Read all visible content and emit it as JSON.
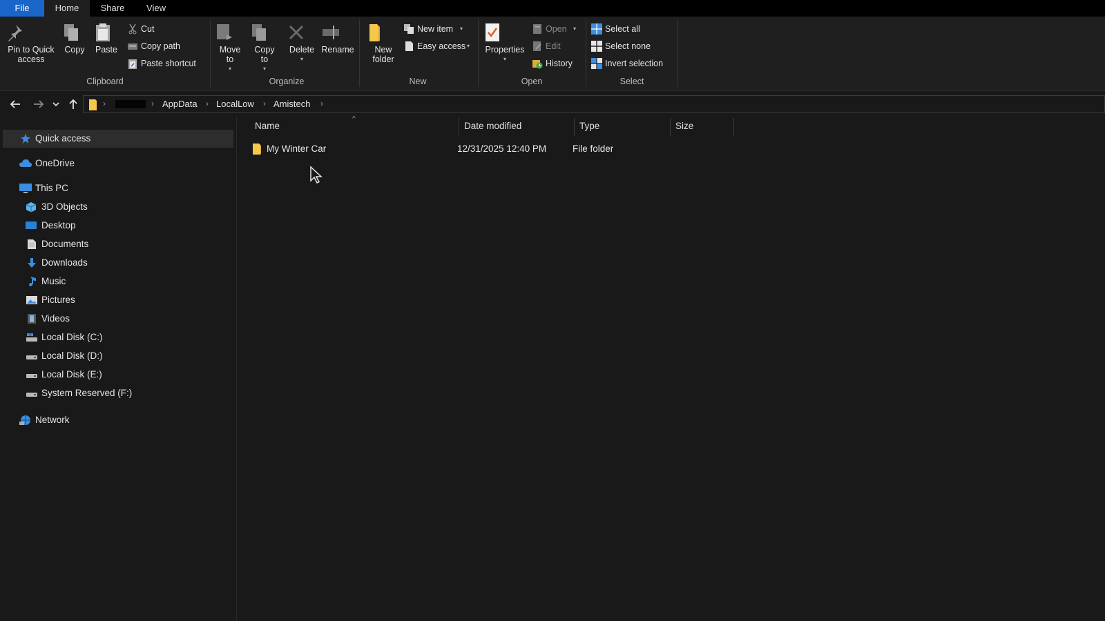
{
  "menu_tabs": {
    "file": "File",
    "home": "Home",
    "share": "Share",
    "view": "View"
  },
  "ribbon": {
    "clipboard": {
      "pin": "Pin to Quick access",
      "copy": "Copy",
      "paste": "Paste",
      "cut": "Cut",
      "copy_path": "Copy path",
      "paste_shortcut": "Paste shortcut",
      "label": "Clipboard"
    },
    "organize": {
      "move_to": "Move to",
      "copy_to": "Copy to",
      "delete": "Delete",
      "rename": "Rename",
      "label": "Organize"
    },
    "new": {
      "new_folder": "New folder",
      "new_item": "New item",
      "easy_access": "Easy access",
      "label": "New"
    },
    "open": {
      "properties": "Properties",
      "open": "Open",
      "edit": "Edit",
      "history": "History",
      "label": "Open"
    },
    "select": {
      "select_all": "Select all",
      "select_none": "Select none",
      "invert_selection": "Invert selection",
      "label": "Select"
    }
  },
  "breadcrumb": [
    "AppData",
    "LocalLow",
    "Amistech"
  ],
  "nav_pane": {
    "quick_access": "Quick access",
    "onedrive": "OneDrive",
    "this_pc": "This PC",
    "this_pc_items": [
      "3D Objects",
      "Desktop",
      "Documents",
      "Downloads",
      "Music",
      "Pictures",
      "Videos",
      "Local Disk (C:)",
      "Local Disk (D:)",
      "Local Disk (E:)",
      "System Reserved (F:)"
    ],
    "network": "Network"
  },
  "columns": {
    "name": "Name",
    "date_modified": "Date modified",
    "type": "Type",
    "size": "Size"
  },
  "files": [
    {
      "name": "My Winter Car",
      "date_modified": "12/31/2025 12:40 PM",
      "type": "File folder",
      "size": ""
    }
  ],
  "colors": {
    "accent": "#1a66c8",
    "folder": "#f5c84c",
    "background": "#191919"
  }
}
